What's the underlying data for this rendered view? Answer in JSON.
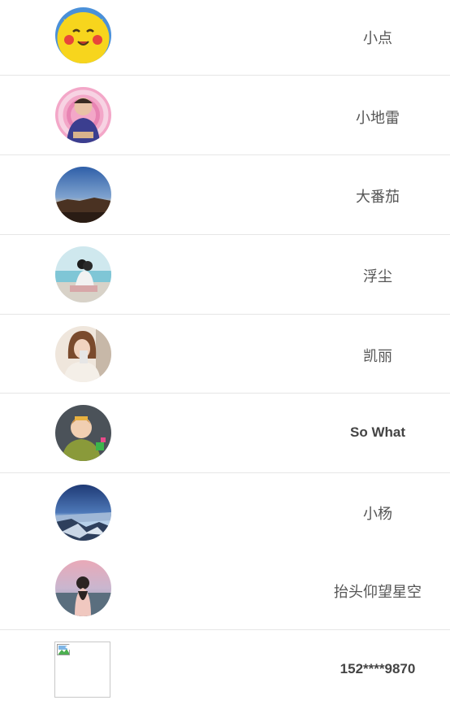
{
  "contacts": [
    {
      "name": "小点",
      "avatar": "pikachu-avatar",
      "has_divider": true
    },
    {
      "name": "小地雷",
      "avatar": "baby-pink-avatar",
      "has_divider": true
    },
    {
      "name": "大番茄",
      "avatar": "sunset-landscape-avatar",
      "has_divider": true
    },
    {
      "name": "浮尘",
      "avatar": "couple-beach-avatar",
      "has_divider": true
    },
    {
      "name": "凯丽",
      "avatar": "woman-portrait-avatar",
      "has_divider": true
    },
    {
      "name": "So What",
      "avatar": "baby-green-avatar",
      "has_divider": true
    },
    {
      "name": "小杨",
      "avatar": "night-city-avatar",
      "has_divider": false
    },
    {
      "name": "抬头仰望星空",
      "avatar": "girl-sky-avatar",
      "has_divider": true
    },
    {
      "name": "152****9870",
      "avatar": "broken-image-icon",
      "has_divider": false
    }
  ],
  "colors": {
    "text": "#555555",
    "divider": "#e6e6e6",
    "background": "#ffffff"
  }
}
